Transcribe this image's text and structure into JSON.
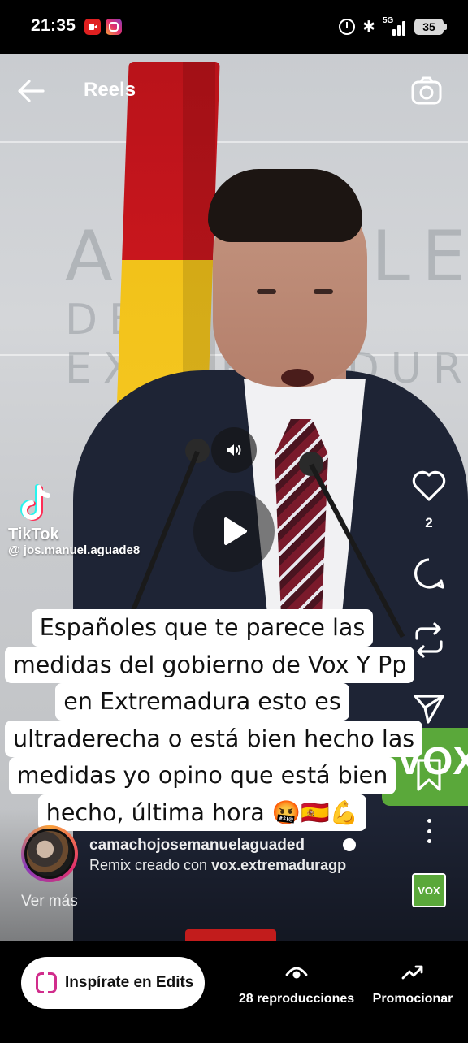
{
  "status_bar": {
    "time": "21:35",
    "battery": "35",
    "network": "5G"
  },
  "header": {
    "title": "Reels"
  },
  "watermark": {
    "brand": "TikTok",
    "handle": "@ jos.manuel.aguade8"
  },
  "actions": {
    "like_count": "2"
  },
  "caption": {
    "lines": [
      "Españoles que te parece las",
      "medidas del gobierno de Vox Y Pp",
      "en Extremadura esto es",
      "ultraderecha o está bien hecho las",
      "medidas yo opino que está bien",
      "hecho, última hora"
    ],
    "emojis": "🤬🇪🇸💪"
  },
  "author": {
    "name": "camachojosemanuelaguaded",
    "remix_prefix": "Remix creado con",
    "remix_source": "vox.extremaduragp",
    "see_more": "Ver más"
  },
  "scene": {
    "wall_text_top": "ASAMBLEA",
    "wall_text_bottom": "DE EXTREMADURA",
    "podium_logo": "VOX",
    "audio_thumb": "VOX"
  },
  "bottom_bar": {
    "edits_label": "Inspírate en Edits",
    "views_label": "28 reproducciones",
    "promote_label": "Promocionar"
  },
  "colors": {
    "accent_vox": "#5aa83a",
    "flag_red": "#c8161d",
    "flag_yellow": "#f2c21a",
    "suit": "#1e2435"
  }
}
